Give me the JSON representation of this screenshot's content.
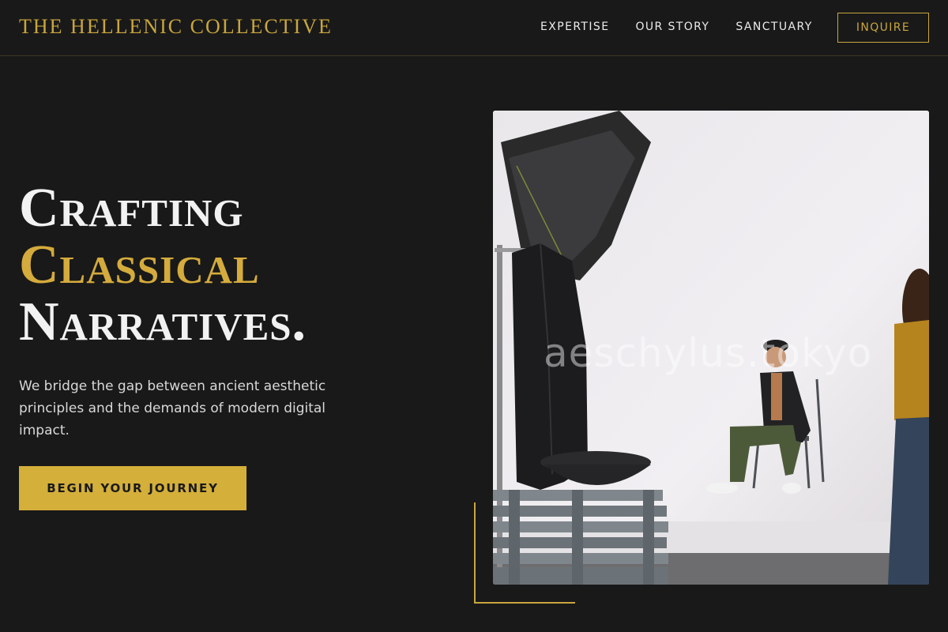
{
  "header": {
    "brand": "THE HELLENIC COLLECTIVE",
    "nav": [
      {
        "label": "EXPERTISE"
      },
      {
        "label": "OUR STORY"
      },
      {
        "label": "SANCTUARY"
      }
    ],
    "inquire_label": "INQUIRE"
  },
  "hero": {
    "headline_line1": "Crafting",
    "headline_line2": "Classical",
    "headline_line3": "Narratives.",
    "subtitle": "We bridge the gap between ancient aesthetic principles and the demands of modern digital impact.",
    "cta_label": "BEGIN YOUR JOURNEY",
    "image_watermark": "aeschylus.tokyo"
  },
  "colors": {
    "background": "#191919",
    "gold": "#d4af3a",
    "text": "#f2f2f2"
  }
}
